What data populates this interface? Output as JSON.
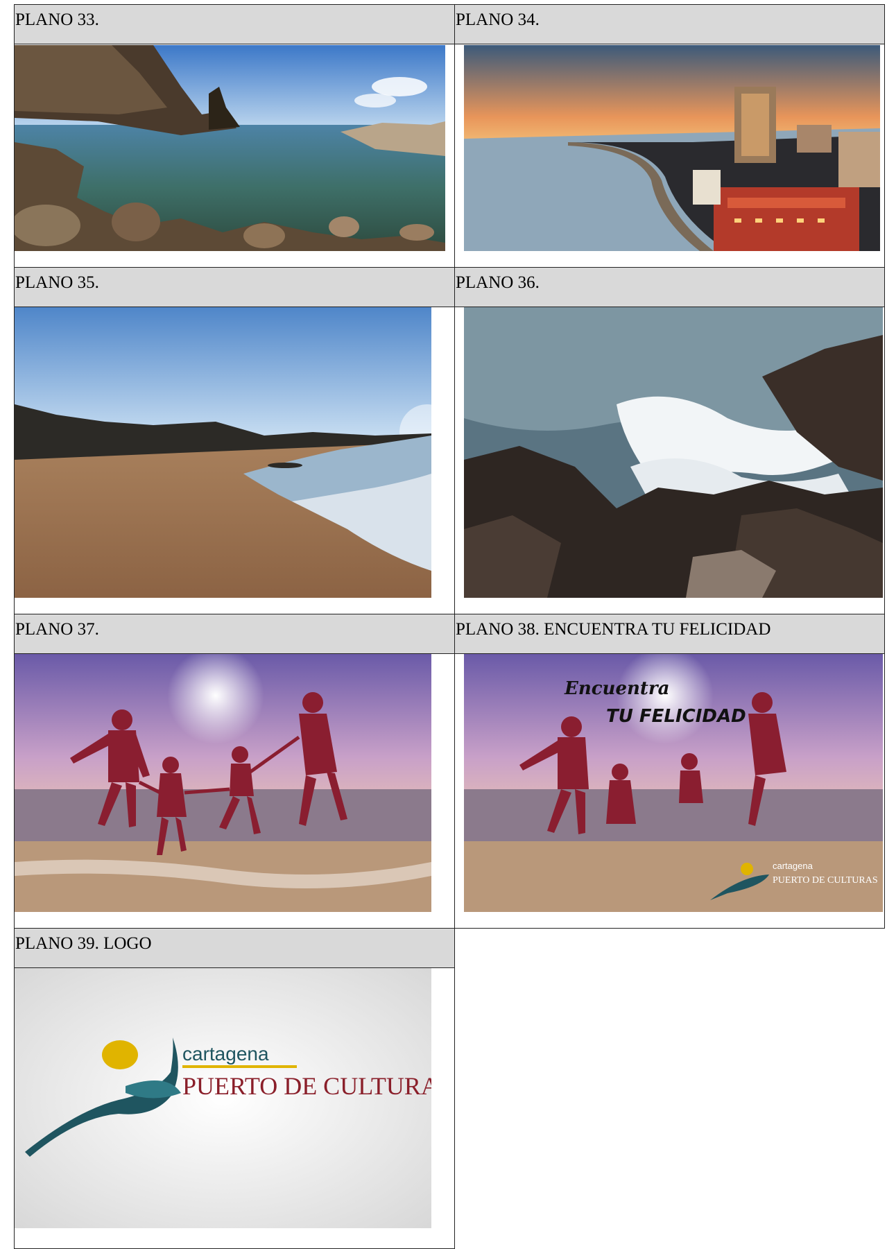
{
  "planos": [
    {
      "title": "PLANO 33."
    },
    {
      "title": "PLANO 34."
    },
    {
      "title": "PLANO 35."
    },
    {
      "title": "PLANO 36."
    },
    {
      "title": "PLANO 37."
    },
    {
      "title": "PLANO 38. ENCUENTRA TU FELICIDAD",
      "overlay_line1": "Encuentra",
      "overlay_line2": "TU FELICIDAD",
      "logo_top": "cartagena",
      "logo_bottom": "PUERTO DE CULTURAS"
    },
    {
      "title": "PLANO 39. LOGO",
      "logo_top": "cartagena",
      "logo_bottom": "PUERTO DE CULTURAS"
    }
  ],
  "colors": {
    "header_bg": "#d9d9d9",
    "logo_teal": "#1f5560",
    "logo_yellow": "#e0b400",
    "logo_red": "#8a1f2a"
  }
}
